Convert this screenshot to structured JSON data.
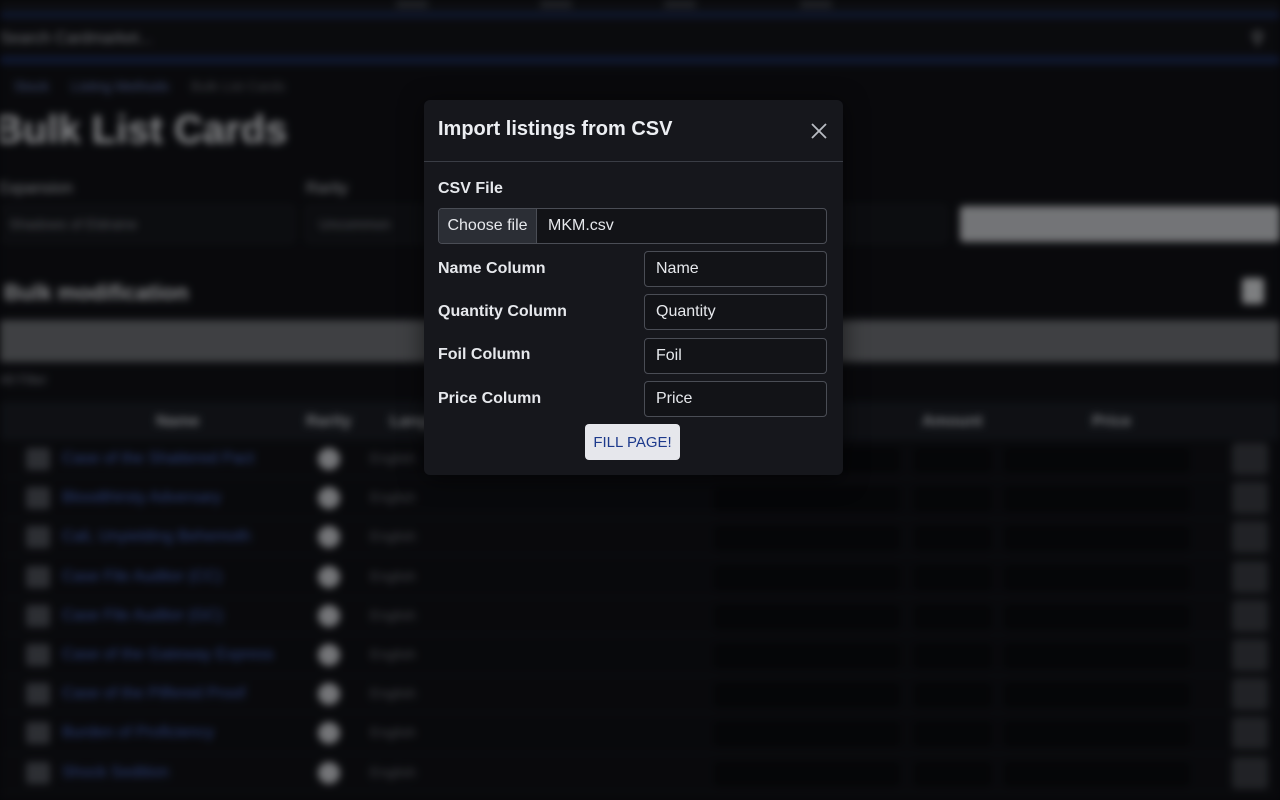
{
  "background": {
    "search_placeholder": "Search Cardmarket...",
    "breadcrumb": [
      "Stock",
      "Listing Methods",
      "Bulk List Cards"
    ],
    "page_title": "Bulk List Cards",
    "filter_labels": [
      "Expansion",
      "Rarity"
    ],
    "filter_values": [
      "Shadows of Eldraine",
      "Uncommon"
    ],
    "section_title": "Bulk modification",
    "small_label": "All Filter",
    "table_headers": [
      "Name",
      "Rarity",
      "Language",
      "Amount",
      "Price"
    ],
    "rows": [
      {
        "name": "Case of the Shattered Pact"
      },
      {
        "name": "Bloodthirsty Adversary"
      },
      {
        "name": "Cali, Unyielding Behemoth"
      },
      {
        "name": "Case File Auditor (CC)"
      },
      {
        "name": "Case File Auditor (GC)"
      },
      {
        "name": "Case of the Gateway Express"
      },
      {
        "name": "Case of the Pilfered Proof"
      },
      {
        "name": "Burden of Proficiency"
      },
      {
        "name": "Shock Sedition"
      }
    ],
    "row_language": "English"
  },
  "modal": {
    "title": "Import listings from CSV",
    "csv_label": "CSV File",
    "choose_file_label": "Choose file",
    "file_name": "MKM.csv",
    "fields": [
      {
        "label": "Name Column",
        "value": "Name"
      },
      {
        "label": "Quantity Column",
        "value": "Quantity"
      },
      {
        "label": "Foil Column",
        "value": "Foil"
      },
      {
        "label": "Price Column",
        "value": "Price"
      }
    ],
    "fill_button_label": "FILL PAGE!"
  },
  "colors": {
    "modal_bg": "#16171c",
    "link": "#4a6cd0",
    "button_text": "#1d3a8c",
    "accent_stripe": "#1b2a55"
  },
  "icons": {
    "close": "close-icon",
    "search": "search-icon",
    "chevron": "chevron-right-icon"
  }
}
